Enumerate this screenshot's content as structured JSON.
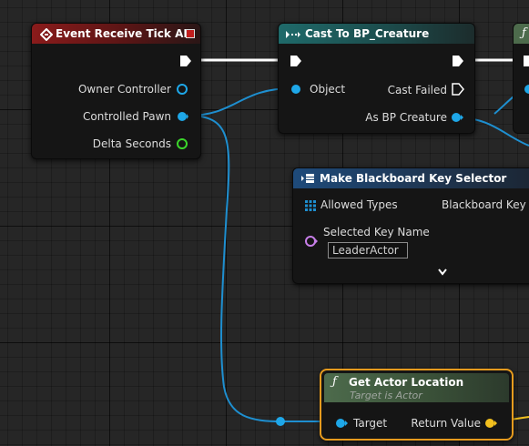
{
  "event_node": {
    "title": "Event Receive Tick AI",
    "pins": {
      "owner_controller": "Owner Controller",
      "controlled_pawn": "Controlled Pawn",
      "delta_seconds": "Delta Seconds"
    }
  },
  "cast_node": {
    "title": "Cast To BP_Creature",
    "pins": {
      "object": "Object",
      "cast_failed": "Cast Failed",
      "as_bp_creature": "As BP Creature"
    }
  },
  "blackboard_node": {
    "title": "Make Blackboard Key Selector",
    "pins": {
      "allowed_types": "Allowed Types",
      "blackboard_key": "Blackboard Key S",
      "selected_key_name": "Selected Key Name"
    },
    "selected_key_value": "LeaderActor"
  },
  "location_node": {
    "title": "Get Actor Location",
    "subtitle": "Target is Actor",
    "pins": {
      "target": "Target",
      "return_value": "Return Value"
    }
  },
  "colors": {
    "exec": "#ffffff",
    "object_pin": "#1ea7e8",
    "float_pin": "#3bd62b",
    "name_pin": "#c77ee8",
    "vector_pin": "#f2c01e",
    "selection": "#e69b1e"
  }
}
